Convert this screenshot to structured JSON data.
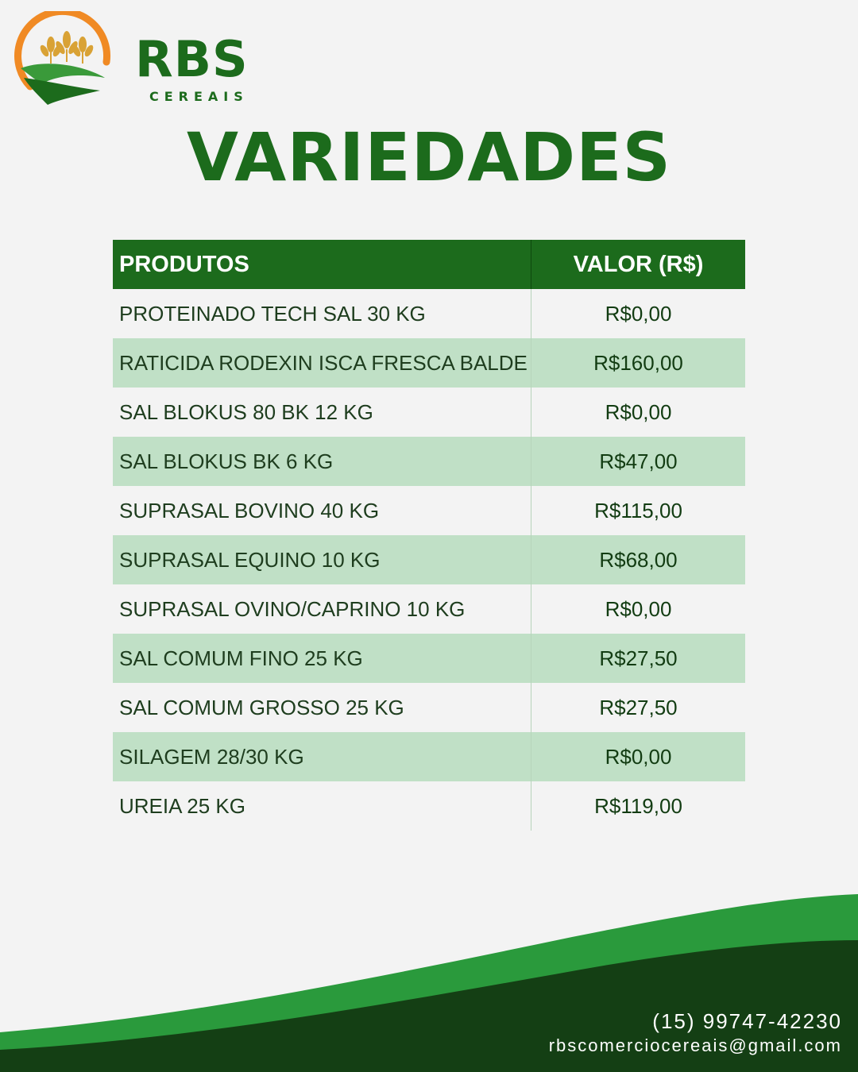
{
  "brand": {
    "name": "RBS",
    "subtitle": "CEREAIS"
  },
  "title": "VARIEDADES",
  "table": {
    "headers": [
      "PRODUTOS",
      "VALOR (R$)"
    ],
    "rows": [
      {
        "product": "PROTEINADO TECH SAL 30 KG",
        "price": "R$0,00"
      },
      {
        "product": "RATICIDA RODEXIN ISCA FRESCA BALDE",
        "price": "R$160,00"
      },
      {
        "product": "SAL BLOKUS 80 BK 12 KG",
        "price": "R$0,00"
      },
      {
        "product": "SAL BLOKUS BK 6 KG",
        "price": "R$47,00"
      },
      {
        "product": "SUPRASAL BOVINO 40 KG",
        "price": "R$115,00"
      },
      {
        "product": "SUPRASAL EQUINO 10 KG",
        "price": "R$68,00"
      },
      {
        "product": "SUPRASAL OVINO/CAPRINO 10 KG",
        "price": "R$0,00"
      },
      {
        "product": "SAL COMUM FINO 25 KG",
        "price": "R$27,50"
      },
      {
        "product": "SAL COMUM GROSSO 25 KG",
        "price": "R$27,50"
      },
      {
        "product": "SILAGEM 28/30 KG",
        "price": "R$0,00"
      },
      {
        "product": "UREIA 25 KG",
        "price": "R$119,00"
      }
    ]
  },
  "contact": {
    "phone": "(15) 99747-42230",
    "email": "rbscomerciocereais@gmail.com"
  },
  "colors": {
    "brand_green": "#1c6b1c",
    "row_alt": "#c0e0c6",
    "background": "#f3f3f3",
    "wave_light": "#2a9a3c",
    "wave_dark": "#143f14",
    "logo_orange": "#f08a24",
    "wheat_gold": "#d9a235"
  },
  "icons": [
    "wheat-logo-icon"
  ]
}
